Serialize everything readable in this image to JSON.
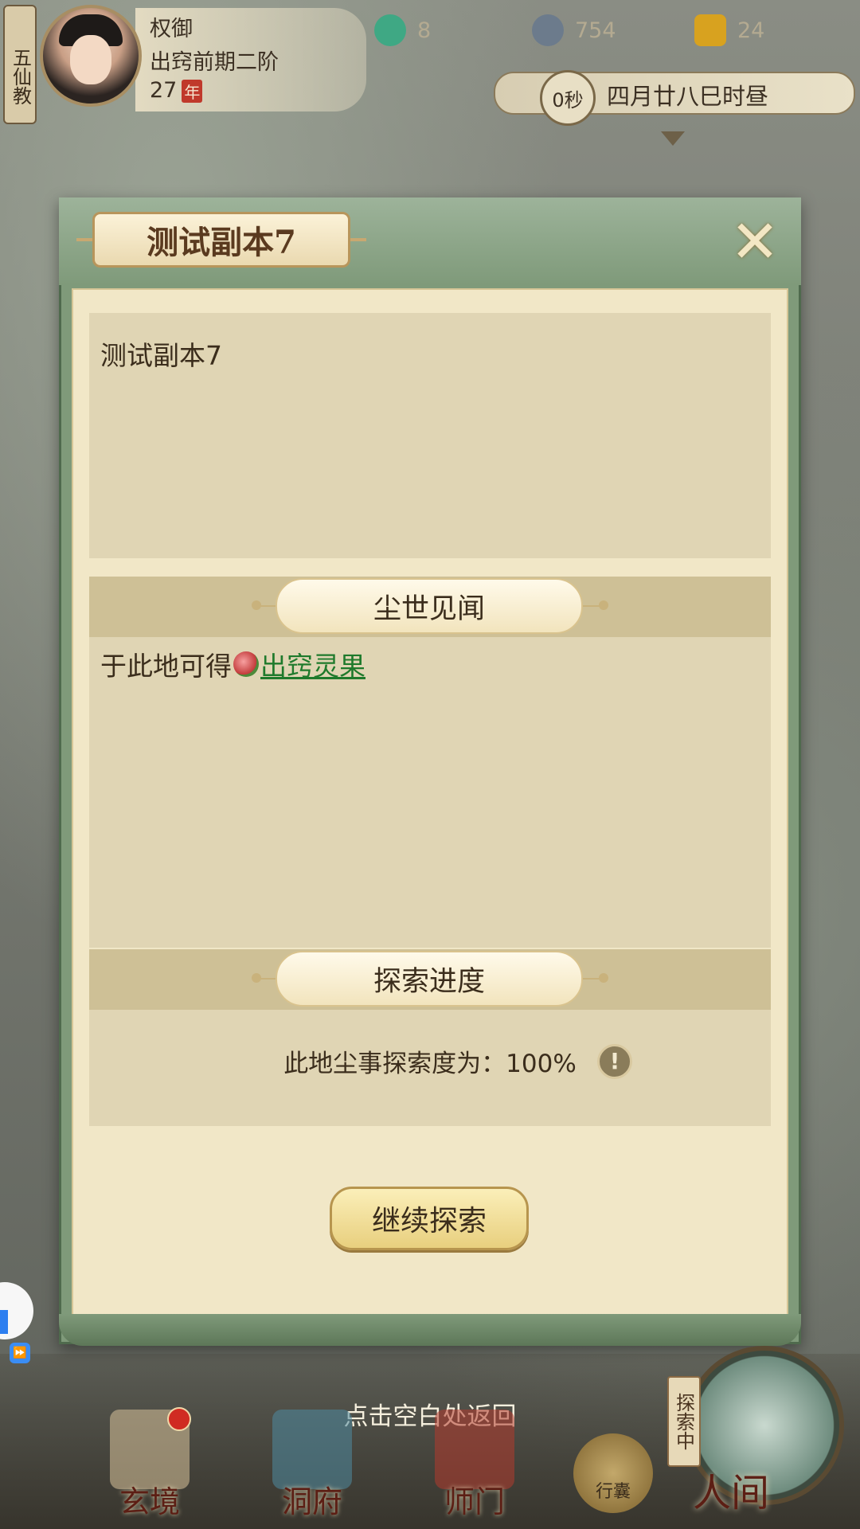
{
  "player": {
    "sect": "五仙教",
    "name": "权御",
    "realm": "出窍前期二阶",
    "age": "27",
    "age_unit": "年"
  },
  "resources": [
    {
      "icon": "jade-dragon-icon",
      "value": "8",
      "color": "#3fa884"
    },
    {
      "icon": "coin-icon",
      "value": "754",
      "color": "#6c7b8c"
    },
    {
      "icon": "gold-ingot-icon",
      "value": "24",
      "color": "#d8a21f"
    }
  ],
  "time": {
    "timer": "0秒",
    "date_text": "四月廿八巳时昼"
  },
  "dialog": {
    "title": "测试副本7",
    "description": "测试副本7",
    "section_drops_title": "尘世见闻",
    "drops_prefix": "于此地可得",
    "drop_item": "出窍灵果",
    "section_progress_title": "探索进度",
    "progress_text": "此地尘事探索度为：100%",
    "progress_percent": 100,
    "continue_button": "继续探索"
  },
  "hint": "点击空白处返回",
  "nav": {
    "items": [
      {
        "label": "玄境"
      },
      {
        "label": "洞府"
      },
      {
        "label": "师门"
      }
    ],
    "bag_label": "行囊",
    "explore_tag": "探索中",
    "world_label": "人间"
  },
  "side": {
    "ff_symbol": "⏩"
  },
  "colors": {
    "dialog_frame": "#7f9a7a",
    "paper": "#f1e7c7",
    "link": "#1f7a2c",
    "button": "#e8cf7e"
  }
}
